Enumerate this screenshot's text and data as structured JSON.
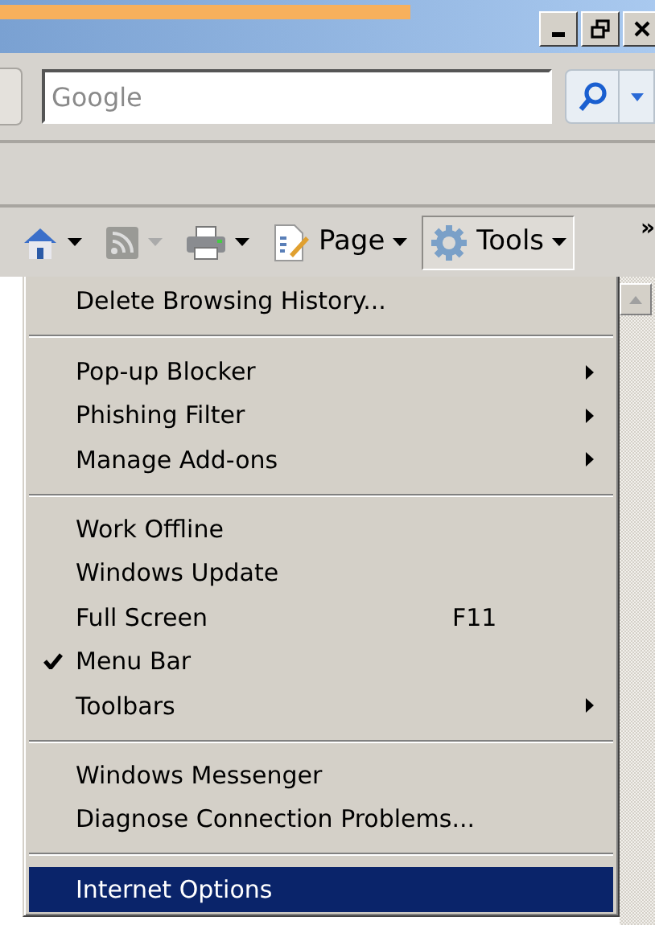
{
  "search": {
    "placeholder": "Google"
  },
  "command_bar": [
    {
      "kind": "home",
      "selected": false,
      "disabled": false
    },
    {
      "kind": "feeds",
      "selected": false,
      "disabled": true
    },
    {
      "kind": "print",
      "selected": false,
      "disabled": false
    },
    {
      "kind": "page",
      "label": "Page",
      "selected": false,
      "disabled": false
    },
    {
      "kind": "tools",
      "label": "Tools",
      "selected": true,
      "disabled": false
    }
  ],
  "overflow": "»",
  "menu": [
    {
      "kind": "item",
      "label": "Delete Browsing History...",
      "checked": false,
      "submenu": false,
      "selected": false
    },
    {
      "kind": "separator"
    },
    {
      "kind": "item",
      "label": "Pop-up Blocker",
      "checked": false,
      "submenu": true,
      "selected": false
    },
    {
      "kind": "item",
      "label": "Phishing Filter",
      "checked": false,
      "submenu": true,
      "selected": false
    },
    {
      "kind": "item",
      "label": "Manage Add-ons",
      "checked": false,
      "submenu": true,
      "selected": false
    },
    {
      "kind": "separator"
    },
    {
      "kind": "item",
      "label": "Work Offline",
      "checked": false,
      "submenu": false,
      "selected": false
    },
    {
      "kind": "item",
      "label": "Windows Update",
      "checked": false,
      "submenu": false,
      "selected": false
    },
    {
      "kind": "item",
      "label": "Full Screen",
      "shortcut": "F11",
      "checked": false,
      "submenu": false,
      "selected": false
    },
    {
      "kind": "item",
      "label": "Menu Bar",
      "checked": true,
      "submenu": false,
      "selected": false
    },
    {
      "kind": "item",
      "label": "Toolbars",
      "checked": false,
      "submenu": true,
      "selected": false
    },
    {
      "kind": "separator"
    },
    {
      "kind": "item",
      "label": "Windows Messenger",
      "checked": false,
      "submenu": false,
      "selected": false
    },
    {
      "kind": "item",
      "label": "Diagnose Connection Problems...",
      "checked": false,
      "submenu": false,
      "selected": false
    },
    {
      "kind": "separator"
    },
    {
      "kind": "item",
      "label": "Internet Options",
      "checked": false,
      "submenu": false,
      "selected": true
    }
  ]
}
